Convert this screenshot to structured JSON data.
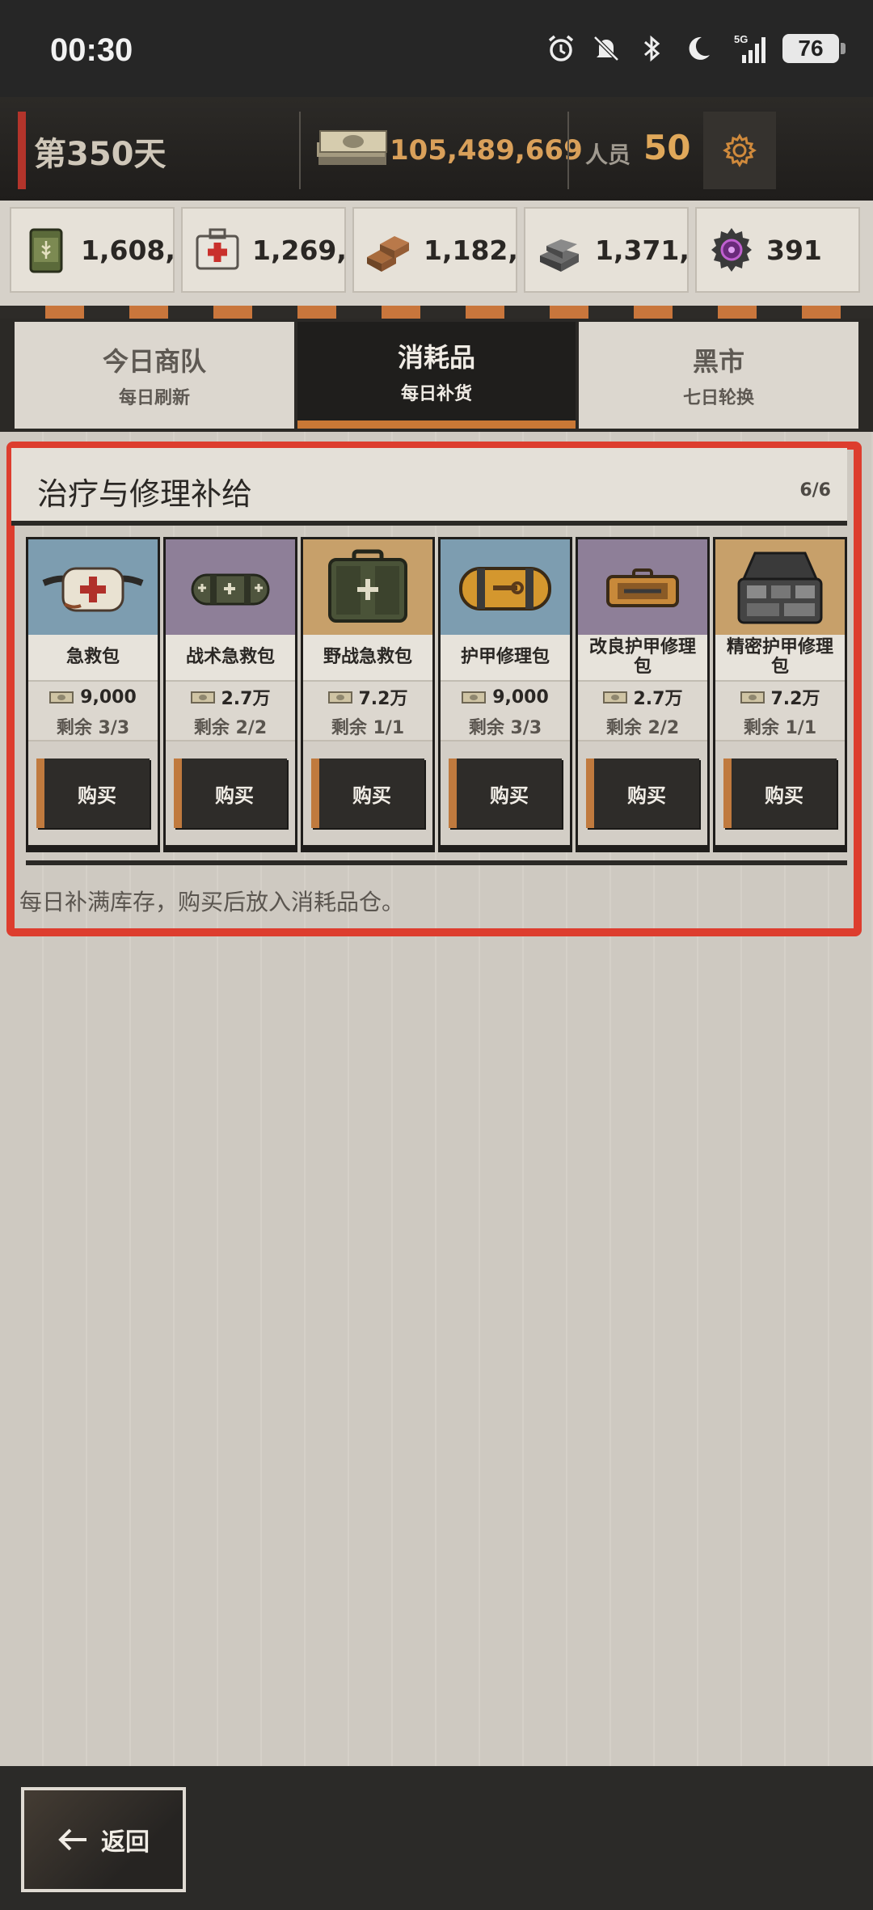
{
  "status_bar": {
    "time": "00:30",
    "battery": "76",
    "network": "5G"
  },
  "header": {
    "day": "第350天",
    "money": "105,489,669",
    "staff_label": "人员",
    "staff_count": "50"
  },
  "resources": [
    {
      "icon": "grain-can-icon",
      "value": "1,608,..."
    },
    {
      "icon": "medkit-icon",
      "value": "1,269,..."
    },
    {
      "icon": "bricks-icon",
      "value": "1,182,..."
    },
    {
      "icon": "steel-ingot-icon",
      "value": "1,371,..."
    },
    {
      "icon": "gear-chip-icon",
      "value": "391"
    }
  ],
  "tabs": [
    {
      "title": "今日商队",
      "subtitle": "每日刷新",
      "active": false
    },
    {
      "title": "消耗品",
      "subtitle": "每日补货",
      "active": true
    },
    {
      "title": "黑市",
      "subtitle": "七日轮换",
      "active": false
    }
  ],
  "panel": {
    "title": "治疗与修理补给",
    "count": "6/6",
    "footnote": "每日补满库存，购买后放入消耗品仓。"
  },
  "items": [
    {
      "name": "急救包",
      "price": "9,000",
      "stock": "剩余 3/3",
      "buy": "购买",
      "bg": "#7d9db0",
      "icon": "first-aid-pouch-icon"
    },
    {
      "name": "战术急救包",
      "price": "2.7万",
      "stock": "剩余 2/2",
      "buy": "购买",
      "bg": "#8e7f98",
      "icon": "tactical-roll-icon"
    },
    {
      "name": "野战急救包",
      "price": "7.2万",
      "stock": "剩余 1/1",
      "buy": "购买",
      "bg": "#c7a06a",
      "icon": "field-medkit-icon"
    },
    {
      "name": "护甲修理包",
      "price": "9,000",
      "stock": "剩余 3/3",
      "buy": "购买",
      "bg": "#7d9db0",
      "icon": "armor-repair-roll-icon"
    },
    {
      "name": "改良护甲修理包",
      "price": "2.7万",
      "stock": "剩余 2/2",
      "buy": "购买",
      "bg": "#8e7f98",
      "icon": "improved-repair-kit-icon"
    },
    {
      "name": "精密护甲修理包",
      "price": "7.2万",
      "stock": "剩余 1/1",
      "buy": "购买",
      "bg": "#c7a06a",
      "icon": "precision-repair-case-icon"
    }
  ],
  "bottom": {
    "back_label": "返回"
  }
}
